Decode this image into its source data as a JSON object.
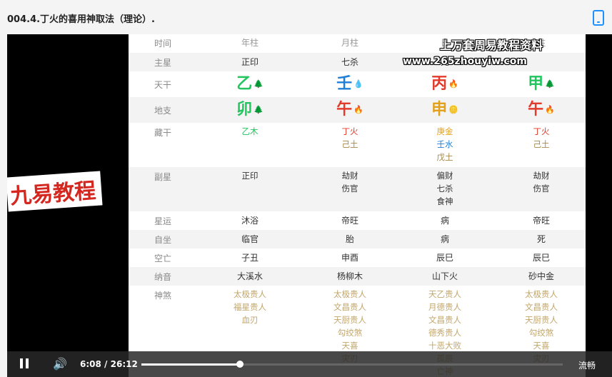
{
  "header": {
    "title": "004.4.丁火的喜用神取法（理论）."
  },
  "watermark": {
    "line1": "上万套周易教程资料",
    "line2": "www.265zhouyiw.com"
  },
  "brand_tag": "九易教程",
  "table": {
    "header": {
      "label": "时间",
      "cols": [
        "年柱",
        "月柱",
        "日",
        "柱"
      ]
    },
    "zhuxing": {
      "label": "主星",
      "cols": [
        "正印",
        "七杀",
        "元",
        ""
      ]
    },
    "tiangan": {
      "label": "天干",
      "cols": [
        {
          "char": "乙",
          "emoji": "🌲",
          "cls": "wood"
        },
        {
          "char": "壬",
          "emoji": "💧",
          "cls": "water"
        },
        {
          "char": "丙",
          "emoji": "🔥",
          "cls": "fire"
        },
        {
          "char": "甲",
          "emoji": "🌲",
          "cls": "wood"
        }
      ]
    },
    "dizhi": {
      "label": "地支",
      "cols": [
        {
          "char": "卯",
          "emoji": "🌲",
          "cls": "wood"
        },
        {
          "char": "午",
          "emoji": "🔥",
          "cls": "fire"
        },
        {
          "char": "申",
          "emoji": "🪙",
          "cls": "metal"
        },
        {
          "char": "午",
          "emoji": "🔥",
          "cls": "fire"
        }
      ]
    },
    "canggan": {
      "label": "藏干",
      "cols": [
        [
          {
            "t": "乙木",
            "cls": "wood"
          }
        ],
        [
          {
            "t": "丁火",
            "cls": "fire"
          },
          {
            "t": "己土",
            "cls": "earth"
          }
        ],
        [
          {
            "t": "庚金",
            "cls": "metal"
          },
          {
            "t": "壬水",
            "cls": "water"
          },
          {
            "t": "戊土",
            "cls": "earth"
          }
        ],
        [
          {
            "t": "丁火",
            "cls": "fire"
          },
          {
            "t": "己土",
            "cls": "earth"
          }
        ]
      ]
    },
    "fuxing": {
      "label": "副星",
      "cols": [
        [
          "正印"
        ],
        [
          "劫财",
          "伤官"
        ],
        [
          "偏财",
          "七杀",
          "食神"
        ],
        [
          "劫财",
          "伤官"
        ]
      ]
    },
    "xingyun": {
      "label": "星运",
      "cols": [
        "沐浴",
        "帝旺",
        "病",
        "帝旺"
      ]
    },
    "zizuo": {
      "label": "自坐",
      "cols": [
        "临官",
        "胎",
        "病",
        "死"
      ]
    },
    "kongwang": {
      "label": "空亡",
      "cols": [
        "子丑",
        "申酉",
        "辰巳",
        "辰巳"
      ]
    },
    "nayin": {
      "label": "纳音",
      "cols": [
        "大溪水",
        "杨柳木",
        "山下火",
        "砂中金"
      ]
    },
    "shensha": {
      "label": "神煞",
      "cols": [
        [
          "太极贵人",
          "福星贵人",
          "血刃"
        ],
        [
          "太极贵人",
          "文昌贵人",
          "天厨贵人",
          "勾绞煞",
          "天喜",
          "灾刃"
        ],
        [
          "天乙贵人",
          "月德贵人",
          "文昌贵人",
          "德秀贵人",
          "十恶大败",
          "孤辰",
          "亡神"
        ],
        [
          "太极贵人",
          "文昌贵人",
          "天厨贵人",
          "勾绞煞",
          "天喜",
          "灾刃"
        ]
      ]
    }
  },
  "player": {
    "time_current": "6:08",
    "time_sep": "/",
    "time_total": "26:12",
    "progress_fraction": 0.234,
    "quality": "流畅"
  }
}
